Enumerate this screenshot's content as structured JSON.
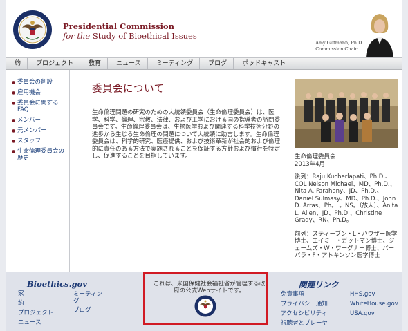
{
  "header": {
    "title_line1": "Presidential Commission",
    "title_line2_italic": "for the",
    "title_line2_rest": " Study of Bioethical Issues",
    "chair_name": "Amy Gutmann, Ph.D.",
    "chair_title": "Commission Chair"
  },
  "nav": {
    "items": [
      "約",
      "プロジェクト",
      "教育",
      "ニュース",
      "ミーティング",
      "ブログ",
      "ポッドキャスト"
    ]
  },
  "sidebar": {
    "items": [
      "委員会の創設",
      "雇用機会",
      "委員会に関するFAQ",
      "メンバー",
      "元メンバー",
      "スタッフ",
      "生命倫理委員会の歴史"
    ]
  },
  "main": {
    "title": "委員会について",
    "text": "生命倫理問題の研究のための大統領委員会（生命倫理委員会）は、医学、科学、倫理、宗教、法律、および工学における国の指導者の諮問委員会です。生命倫理委員会は、生物医学および関連する科学技術分野の進歩から生じる生命倫理の問題について大統領に助言します。生命倫理委員会は、科学的研究、医療提供、および技術革新が社会的および倫理的に責任のある方法で実施されることを保証する方針および慣行を特定し、促進することを目指しています。"
  },
  "right_column": {
    "caption_line1": "生命倫理委員会",
    "caption_line2": "2013年4月",
    "attendees": "後列：Raju Kucherlapati、Ph.D.、COL Nelson Michael、MD、Ph.D.、Nita A. Farahany、JD、Ph.D.、Daniel Sulmasy、MD、Ph.D.、John D. Arras、Ph。 。NS。（故人）、Anita L. Allen、JD、Ph.D.、Christine Grady、RN、Ph.D。",
    "front_row": "前列：スティーブン・L・ハウザー医学博士、エイミー・ガットマン博士、ジェームズ・W・ワーグナー博士、バーバラ・F・アトキンソン医学博士"
  },
  "footer": {
    "bioethics_title": "Bioethics.gov",
    "bioethics_links_col1": [
      "家",
      "約",
      "プロジェクト",
      "ニュース"
    ],
    "bioethics_links_col2": [
      "ミーティング",
      "ブログ"
    ],
    "hhs_text": "これは、米国保健社会福祉省が管理する政府の公式Webサイトです。",
    "related_title": "関連リンク",
    "related_links_col1": [
      "免責事項",
      "プライバシー通知",
      "アクセシビリティ",
      "視聴者とプレーヤ"
    ],
    "related_links_col2": [
      "HHS.gov",
      "WhiteHouse.gov",
      "USA.gov"
    ]
  },
  "colors": {
    "brand_maroon": "#7a1a25",
    "link_blue": "#1a3e7a",
    "highlight_red": "#d11a24",
    "footer_bg": "#dfe2ea"
  }
}
